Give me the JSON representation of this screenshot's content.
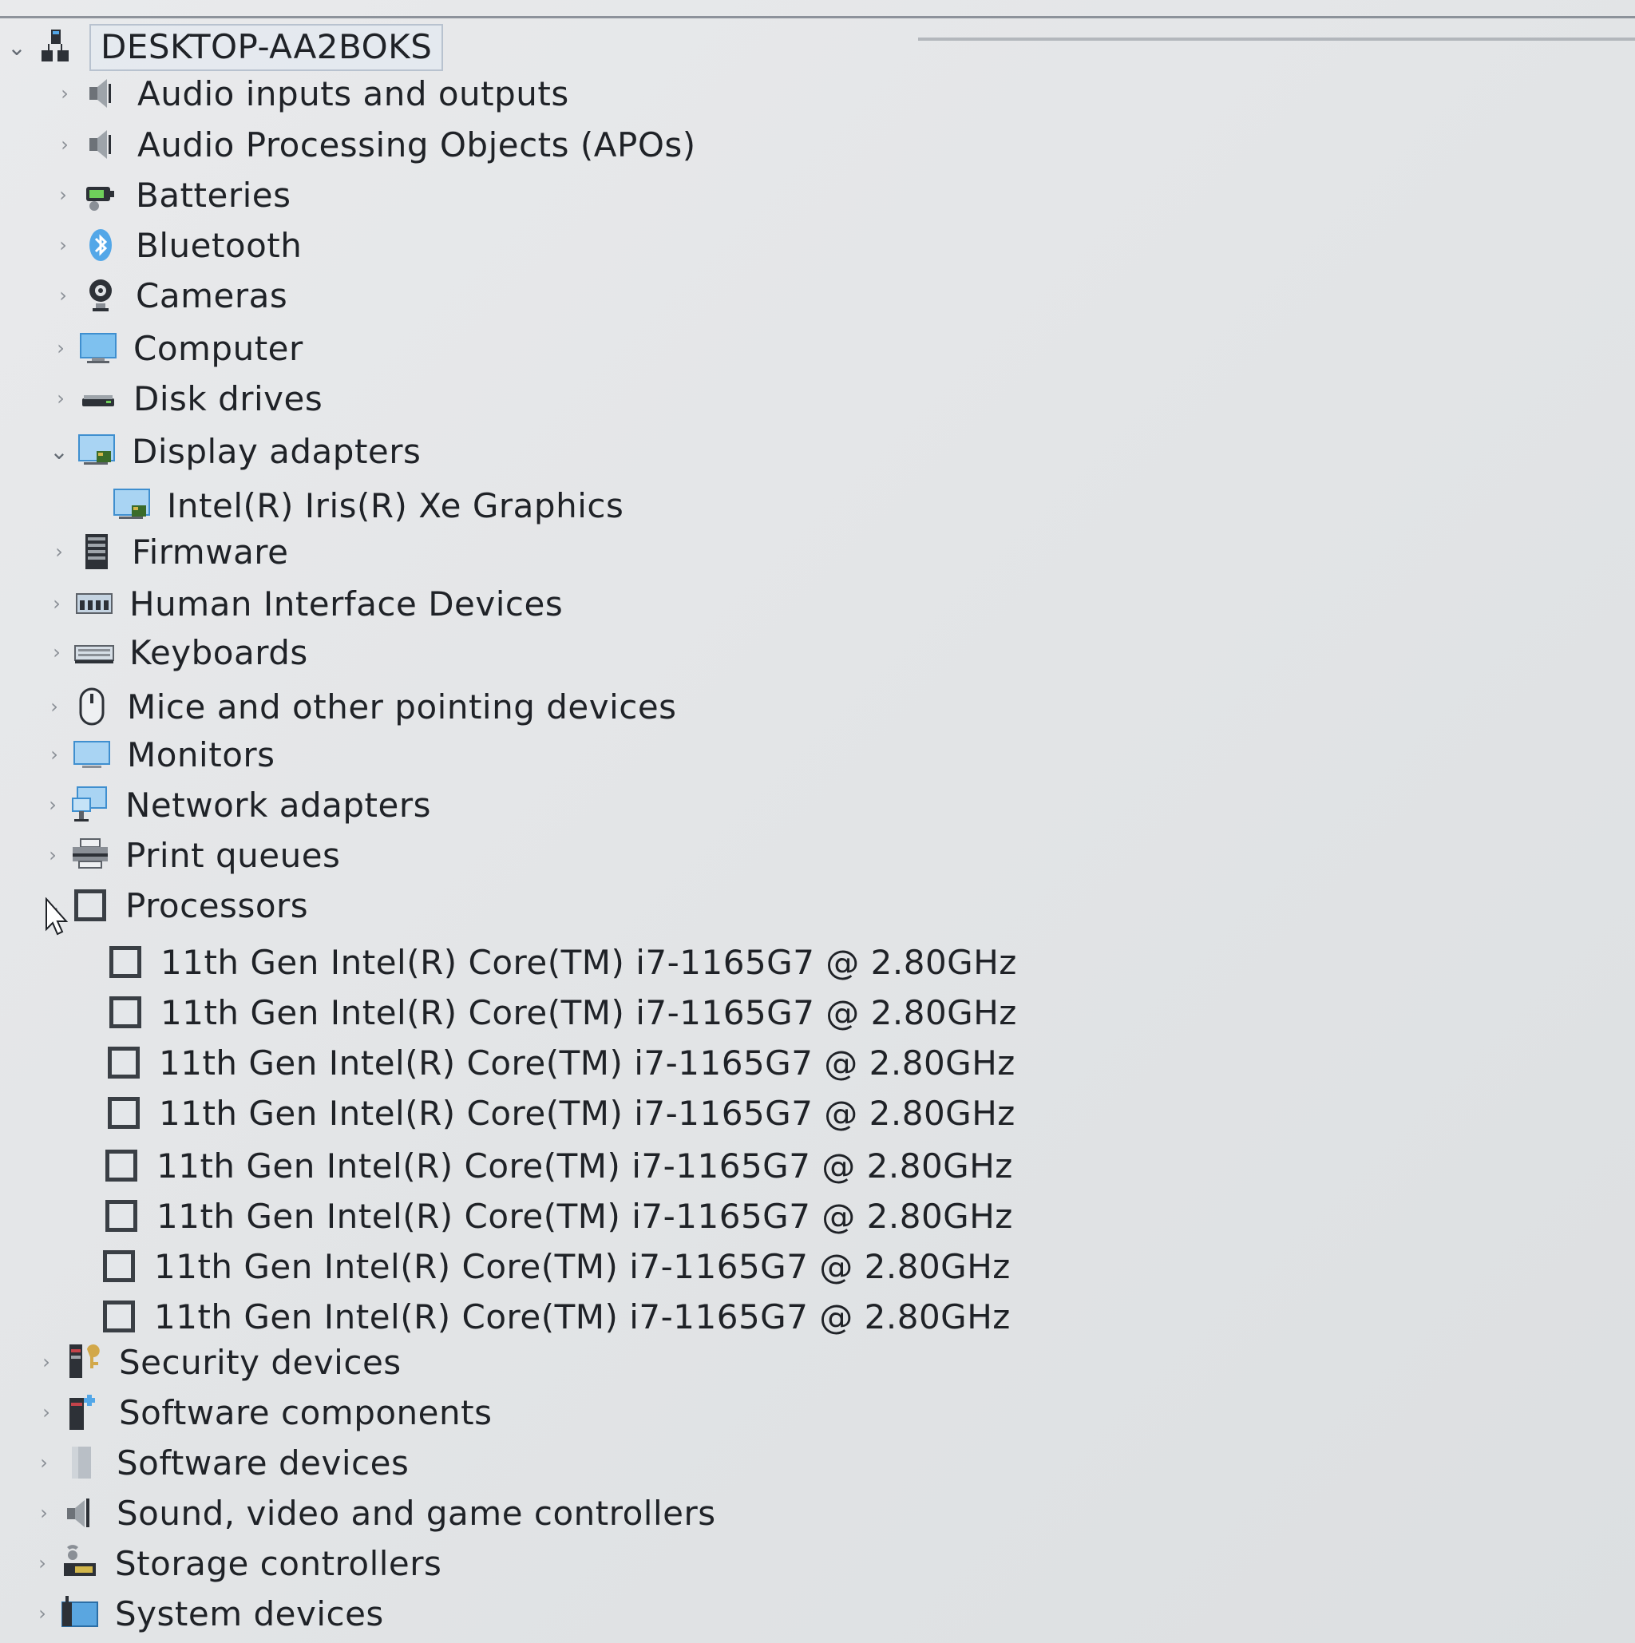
{
  "root": {
    "label": "DESKTOP-AA2BOKS"
  },
  "categories": [
    {
      "label": "Audio inputs and outputs",
      "icon": "speaker-icon",
      "expanded": false
    },
    {
      "label": "Audio Processing Objects (APOs)",
      "icon": "speaker-icon",
      "expanded": false
    },
    {
      "label": "Batteries",
      "icon": "battery-icon",
      "expanded": false
    },
    {
      "label": "Bluetooth",
      "icon": "bluetooth-icon",
      "expanded": false
    },
    {
      "label": "Cameras",
      "icon": "camera-icon",
      "expanded": false
    },
    {
      "label": "Computer",
      "icon": "computer-icon",
      "expanded": false
    },
    {
      "label": "Disk drives",
      "icon": "disk-drive-icon",
      "expanded": false
    },
    {
      "label": "Display adapters",
      "icon": "display-adapter-icon",
      "expanded": true
    },
    {
      "label": "Intel(R) Iris(R) Xe Graphics",
      "icon": "display-adapter-icon",
      "expanded": null
    },
    {
      "label": "Firmware",
      "icon": "firmware-icon",
      "expanded": false
    },
    {
      "label": "Human Interface Devices",
      "icon": "hid-icon",
      "expanded": false
    },
    {
      "label": "Keyboards",
      "icon": "keyboard-icon",
      "expanded": false
    },
    {
      "label": "Mice and other pointing devices",
      "icon": "mouse-icon",
      "expanded": false
    },
    {
      "label": "Monitors",
      "icon": "monitor-icon",
      "expanded": false
    },
    {
      "label": "Network adapters",
      "icon": "network-adapter-icon",
      "expanded": false
    },
    {
      "label": "Print queues",
      "icon": "printer-icon",
      "expanded": false
    },
    {
      "label": "Processors",
      "icon": "processor-icon",
      "expanded": true
    },
    {
      "label": "11th Gen Intel(R) Core(TM) i7-1165G7 @ 2.80GHz",
      "icon": "processor-icon",
      "expanded": null
    },
    {
      "label": "11th Gen Intel(R) Core(TM) i7-1165G7 @ 2.80GHz",
      "icon": "processor-icon",
      "expanded": null
    },
    {
      "label": "11th Gen Intel(R) Core(TM) i7-1165G7 @ 2.80GHz",
      "icon": "processor-icon",
      "expanded": null
    },
    {
      "label": "11th Gen Intel(R) Core(TM) i7-1165G7 @ 2.80GHz",
      "icon": "processor-icon",
      "expanded": null
    },
    {
      "label": "11th Gen Intel(R) Core(TM) i7-1165G7 @ 2.80GHz",
      "icon": "processor-icon",
      "expanded": null
    },
    {
      "label": "11th Gen Intel(R) Core(TM) i7-1165G7 @ 2.80GHz",
      "icon": "processor-icon",
      "expanded": null
    },
    {
      "label": "11th Gen Intel(R) Core(TM) i7-1165G7 @ 2.80GHz",
      "icon": "processor-icon",
      "expanded": null
    },
    {
      "label": "11th Gen Intel(R) Core(TM) i7-1165G7 @ 2.80GHz",
      "icon": "processor-icon",
      "expanded": null
    },
    {
      "label": "Security devices",
      "icon": "security-device-icon",
      "expanded": false
    },
    {
      "label": "Software components",
      "icon": "software-component-icon",
      "expanded": false
    },
    {
      "label": "Software devices",
      "icon": "software-device-icon",
      "expanded": false
    },
    {
      "label": "Sound, video and game controllers",
      "icon": "sound-controller-icon",
      "expanded": false
    },
    {
      "label": "Storage controllers",
      "icon": "storage-controller-icon",
      "expanded": false
    },
    {
      "label": "System devices",
      "icon": "system-device-icon",
      "expanded": false
    }
  ],
  "colors": {
    "background": "#e6e8ea",
    "text": "#1f2227",
    "selection_border": "#b8c2cf",
    "icon_blue": "#53a7e8",
    "icon_dark": "#2d3137"
  }
}
